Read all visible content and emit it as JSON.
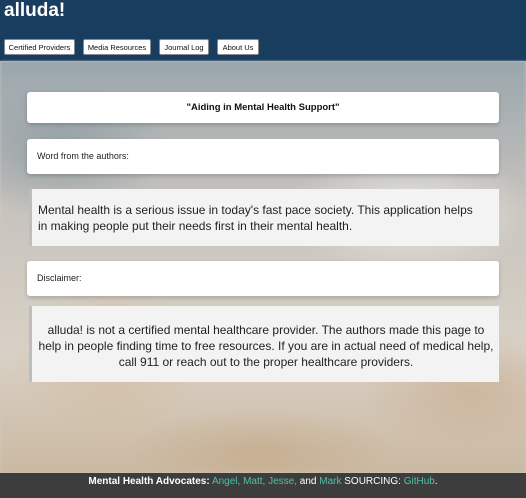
{
  "header": {
    "brand": "alluda!"
  },
  "nav": {
    "certified_providers": "Certified Providers",
    "media_resources": "Media Resources",
    "journal_log": "Journal Log",
    "about_us": "About Us"
  },
  "main": {
    "title": "\"Aiding in Mental Health Support\"",
    "authors_label": "Word from the authors:",
    "authors_text": "Mental health is a serious issue in today's fast pace society. This application helps in making people put their needs first in their mental health.",
    "disclaimer_label": "Disclaimer:",
    "disclaimer_text": "alluda! is not a certified mental healthcare provider. The authors made this page to help in people finding time to free resources. If you are in actual need of medical help, call 911 or reach out to the proper healthcare providers."
  },
  "footer": {
    "advocates_label": "Mental Health Advocates:",
    "authors": [
      "Angel,",
      "Matt,",
      "Jesse,",
      "Mark"
    ],
    "and_word": "and",
    "sourcing_label": "SOURCING:",
    "source_link": "GitHub",
    "end_period": "."
  },
  "colors": {
    "header_bg": "#183d5e",
    "footer_bg": "#3d3d3d",
    "link": "#4fc2a6"
  }
}
